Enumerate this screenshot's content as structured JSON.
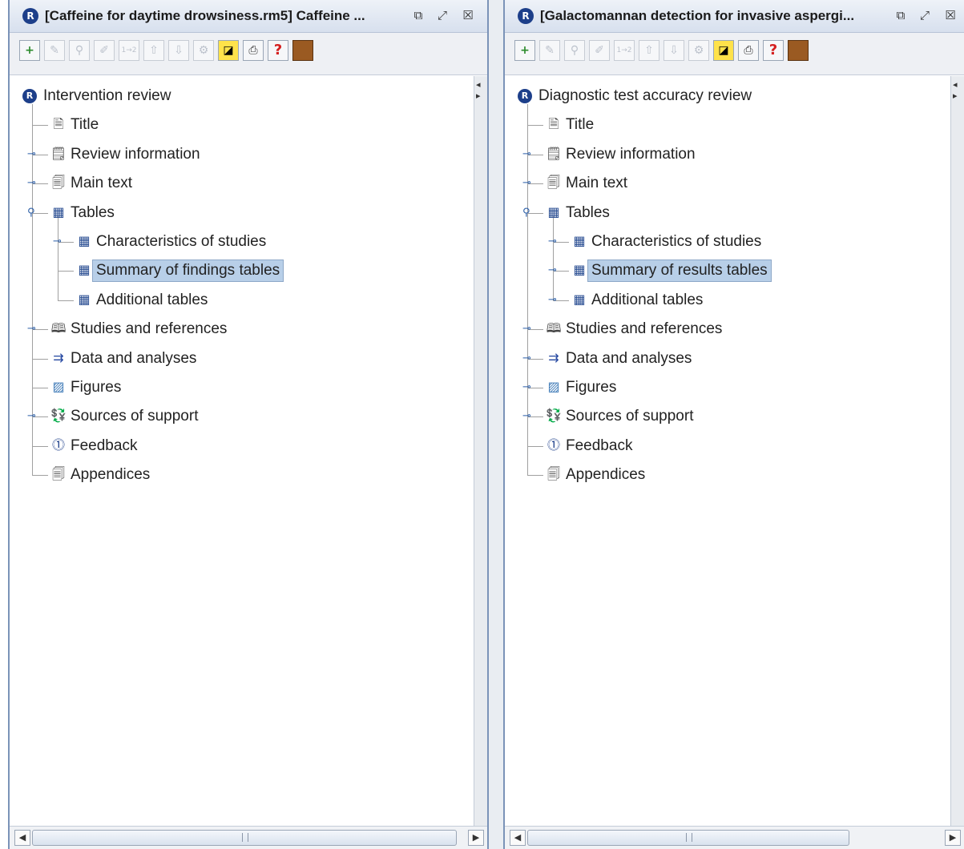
{
  "panels": [
    {
      "id": "p1",
      "title": "[Caffeine for daytime drowsiness.rm5] Caffeine ...",
      "tree": [
        {
          "label": "Intervention review",
          "depth": 0,
          "icon": "review-r-icon",
          "expander": false,
          "connector": false,
          "selected": false
        },
        {
          "label": "Title",
          "depth": 1,
          "icon": "document-icon",
          "expander": false,
          "connector": true,
          "selected": false
        },
        {
          "label": "Review information",
          "depth": 1,
          "icon": "form-icon",
          "expander": true,
          "connector": true,
          "selected": false
        },
        {
          "label": "Main text",
          "depth": 1,
          "icon": "pages-icon",
          "expander": true,
          "connector": true,
          "selected": false
        },
        {
          "label": "Tables",
          "depth": 1,
          "icon": "table-icon",
          "expander": true,
          "expanded": true,
          "connector": true,
          "selected": false
        },
        {
          "label": "Characteristics of studies",
          "depth": 2,
          "icon": "table-icon",
          "expander": true,
          "connector": true,
          "selected": false
        },
        {
          "label": "Summary of findings tables",
          "depth": 2,
          "icon": "table-icon",
          "expander": false,
          "connector": true,
          "selected": true
        },
        {
          "label": "Additional tables",
          "depth": 2,
          "icon": "table-icon",
          "expander": false,
          "connector": true,
          "selected": false
        },
        {
          "label": "Studies and references",
          "depth": 1,
          "icon": "book-icon",
          "expander": true,
          "connector": true,
          "selected": false
        },
        {
          "label": "Data and analyses",
          "depth": 1,
          "icon": "analysis-icon",
          "expander": false,
          "connector": true,
          "selected": false
        },
        {
          "label": "Figures",
          "depth": 1,
          "icon": "image-icon",
          "expander": false,
          "connector": true,
          "selected": false
        },
        {
          "label": "Sources of support",
          "depth": 1,
          "icon": "money-icon",
          "expander": true,
          "connector": true,
          "selected": false
        },
        {
          "label": "Feedback",
          "depth": 1,
          "icon": "feedback-icon",
          "expander": false,
          "connector": true,
          "selected": false
        },
        {
          "label": "Appendices",
          "depth": 1,
          "icon": "pages-icon",
          "expander": false,
          "connector": true,
          "selected": false
        }
      ]
    },
    {
      "id": "p2",
      "title": "[Galactomannan detection for invasive aspergi...",
      "tree": [
        {
          "label": "Diagnostic test accuracy review",
          "depth": 0,
          "icon": "review-r-icon",
          "expander": false,
          "connector": false,
          "selected": false
        },
        {
          "label": "Title",
          "depth": 1,
          "icon": "document-icon",
          "expander": false,
          "connector": true,
          "selected": false
        },
        {
          "label": "Review information",
          "depth": 1,
          "icon": "form-icon",
          "expander": true,
          "connector": true,
          "selected": false
        },
        {
          "label": "Main text",
          "depth": 1,
          "icon": "pages-icon",
          "expander": true,
          "connector": true,
          "selected": false
        },
        {
          "label": "Tables",
          "depth": 1,
          "icon": "table-icon",
          "expander": true,
          "expanded": true,
          "connector": true,
          "selected": false
        },
        {
          "label": "Characteristics of studies",
          "depth": 2,
          "icon": "table-icon",
          "expander": true,
          "connector": true,
          "selected": false
        },
        {
          "label": "Summary of results tables",
          "depth": 2,
          "icon": "table-icon",
          "expander": true,
          "connector": true,
          "selected": true
        },
        {
          "label": "Additional tables",
          "depth": 2,
          "icon": "table-icon",
          "expander": true,
          "connector": true,
          "selected": false
        },
        {
          "label": "Studies and references",
          "depth": 1,
          "icon": "book-icon",
          "expander": true,
          "connector": true,
          "selected": false
        },
        {
          "label": "Data and analyses",
          "depth": 1,
          "icon": "analysis-icon",
          "expander": true,
          "connector": true,
          "selected": false
        },
        {
          "label": "Figures",
          "depth": 1,
          "icon": "image-icon",
          "expander": true,
          "connector": true,
          "selected": false
        },
        {
          "label": "Sources of support",
          "depth": 1,
          "icon": "money-icon",
          "expander": true,
          "connector": true,
          "selected": false
        },
        {
          "label": "Feedback",
          "depth": 1,
          "icon": "feedback-icon",
          "expander": false,
          "connector": true,
          "selected": false
        },
        {
          "label": "Appendices",
          "depth": 1,
          "icon": "pages-icon",
          "expander": false,
          "connector": true,
          "selected": false
        }
      ]
    }
  ],
  "toolbar": [
    {
      "name": "add-section-icon",
      "glyph": "+",
      "state": "enabled",
      "style": "new"
    },
    {
      "name": "edit-properties-icon",
      "glyph": "✎",
      "state": "disabled",
      "style": ""
    },
    {
      "name": "find-icon",
      "glyph": "⚲",
      "state": "disabled",
      "style": ""
    },
    {
      "name": "edit-text-icon",
      "glyph": "✐",
      "state": "disabled",
      "style": ""
    },
    {
      "name": "sort-icon",
      "glyph": "1→2",
      "state": "disabled",
      "style": ""
    },
    {
      "name": "move-up-icon",
      "glyph": "⇧",
      "state": "disabled",
      "style": ""
    },
    {
      "name": "move-down-icon",
      "glyph": "⇩",
      "state": "disabled",
      "style": ""
    },
    {
      "name": "tools-icon",
      "glyph": "⚙",
      "state": "disabled",
      "style": ""
    },
    {
      "name": "note-icon",
      "glyph": "◪",
      "state": "enabled",
      "style": "note"
    },
    {
      "name": "print-icon",
      "glyph": "⎙",
      "state": "enabled",
      "style": "print"
    },
    {
      "name": "help-icon",
      "glyph": "?",
      "state": "enabled",
      "style": "help"
    },
    {
      "name": "handbook-icon",
      "glyph": "",
      "state": "enabled",
      "style": "book"
    }
  ],
  "window_buttons": [
    {
      "name": "restore-icon",
      "glyph": "⧉"
    },
    {
      "name": "maximize-icon",
      "glyph": "⤢"
    },
    {
      "name": "close-icon",
      "glyph": "☒"
    }
  ],
  "icons": {
    "review-r-icon": "R",
    "document-icon": "🗎",
    "form-icon": "🗒",
    "pages-icon": "🗐",
    "table-icon": "▦",
    "book-icon": "🕮",
    "analysis-icon": "⇉",
    "image-icon": "▨",
    "money-icon": "💱",
    "feedback-icon": "⓵"
  },
  "colors": {
    "selection": "#b8cfe8",
    "tree_handle": "#2b5ea7",
    "app_icon": "#1d3f8a"
  }
}
